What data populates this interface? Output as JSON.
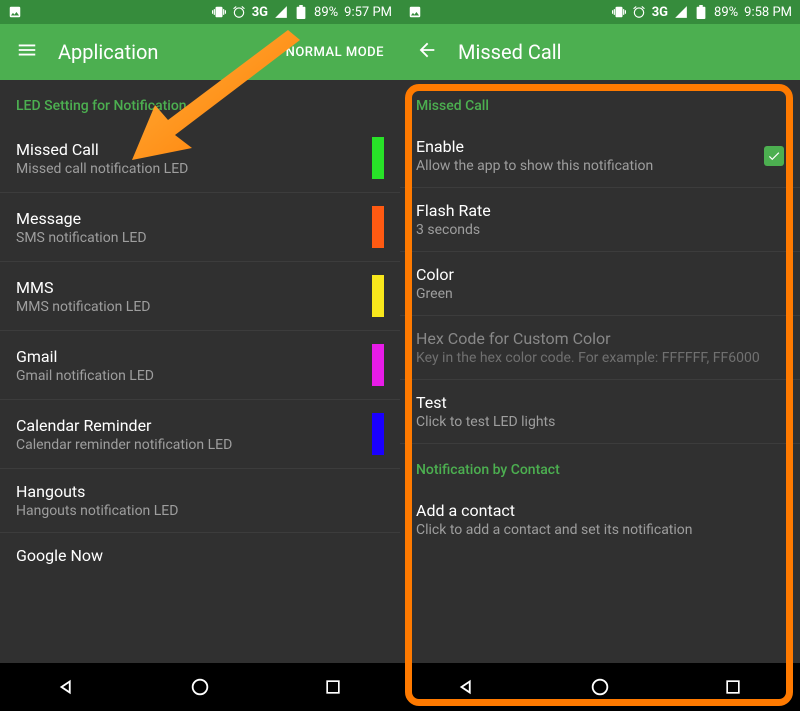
{
  "left": {
    "status": {
      "network": "3G",
      "battery": "89%",
      "time": "9:57 PM"
    },
    "title": "Application",
    "mode": "NORMAL MODE",
    "section": "LED Setting for Notification",
    "items": [
      {
        "title": "Missed Call",
        "sub": "Missed call notification LED",
        "color": "#28e228"
      },
      {
        "title": "Message",
        "sub": "SMS notification LED",
        "color": "#ff5a12"
      },
      {
        "title": "MMS",
        "sub": "MMS notification LED",
        "color": "#f8e71c"
      },
      {
        "title": "Gmail",
        "sub": "Gmail notification LED",
        "color": "#e81ce8"
      },
      {
        "title": "Calendar Reminder",
        "sub": "Calendar reminder notification LED",
        "color": "#1a00ff"
      },
      {
        "title": "Hangouts",
        "sub": "Hangouts notification LED",
        "color": ""
      },
      {
        "title": "Google Now",
        "sub": "",
        "color": ""
      }
    ]
  },
  "right": {
    "status": {
      "network": "3G",
      "battery": "89%",
      "time": "9:58 PM"
    },
    "title": "Missed Call",
    "section1": "Missed Call",
    "items": [
      {
        "title": "Enable",
        "sub": "Allow the app to show this notification",
        "checkbox": true
      },
      {
        "title": "Flash Rate",
        "sub": "3 seconds"
      },
      {
        "title": "Color",
        "sub": "Green"
      },
      {
        "title": "Hex Code for Custom Color",
        "sub": "Key in the hex color code. For example: FFFFFF, FF6000",
        "disabled": true
      },
      {
        "title": "Test",
        "sub": "Click to test LED lights"
      }
    ],
    "section2": "Notification by Contact",
    "items2": [
      {
        "title": "Add a contact",
        "sub": "Click to add a contact and set its notification"
      }
    ]
  }
}
